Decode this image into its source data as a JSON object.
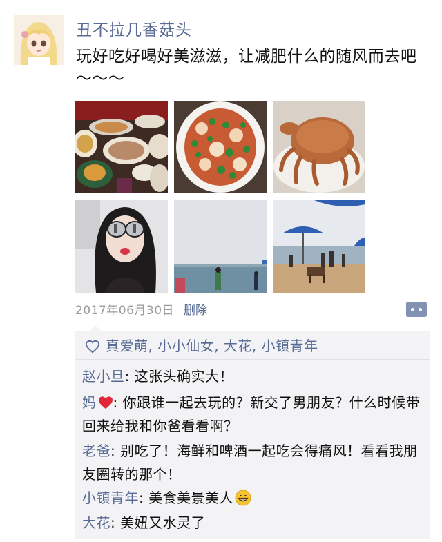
{
  "post": {
    "username": "丑不拉几香菇头",
    "text": "玩好吃好喝好美滋滋，让减肥什么的随风而去吧～～～",
    "date": "2017年06月30日",
    "delete_label": "删除"
  },
  "photos": [
    {
      "subject": "food-platters"
    },
    {
      "subject": "shrimp-vegetable-dish"
    },
    {
      "subject": "crab"
    },
    {
      "subject": "selfie-sunglasses"
    },
    {
      "subject": "beach-sea"
    },
    {
      "subject": "beach-umbrellas"
    }
  ],
  "likes": {
    "icon": "heart-outline-icon",
    "names": "真爱萌, 小小仙女, 大花, 小镇青年"
  },
  "comments": [
    {
      "author": "赵小旦",
      "sep": ": ",
      "text": "这张头确实大！",
      "emoji": ""
    },
    {
      "author": "妈",
      "sep": ": ",
      "text": "你跟谁一起去玩的？新交了男朋友？什么时候带回来给我和你爸看看啊？",
      "emoji": "red-heart"
    },
    {
      "author": "老爸",
      "sep": ": ",
      "text": "别吃了！海鲜和啤酒一起吃会得痛风！看看我朋友圈转的那个！",
      "emoji": ""
    },
    {
      "author": "小镇青年",
      "sep": ": ",
      "text": "美食美景美人",
      "emoji": "grinning-face"
    },
    {
      "author": "大花",
      "sep": ": ",
      "text": "美妞又水灵了",
      "emoji": ""
    }
  ],
  "colors": {
    "link": "#576b95",
    "comment_bg": "#f3f3f5",
    "date": "#999999",
    "more_button": "#8292b4"
  }
}
